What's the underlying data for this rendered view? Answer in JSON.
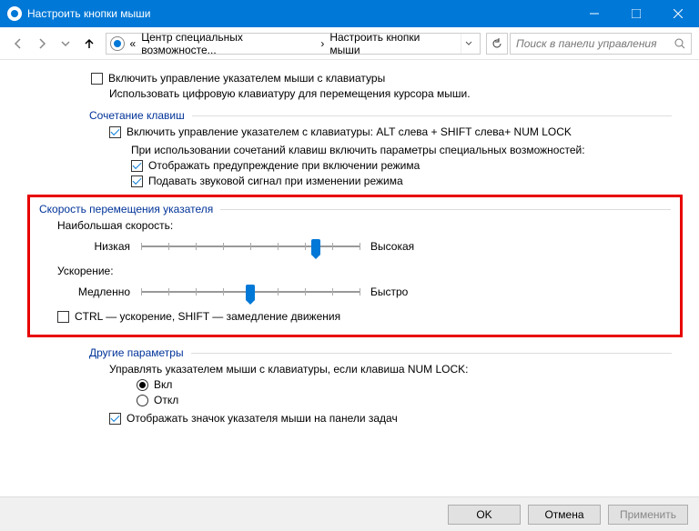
{
  "window": {
    "title": "Настроить кнопки мыши"
  },
  "breadcrumb": {
    "sep1": "«",
    "p1": "Центр специальных возможносте...",
    "sep2": "›",
    "p2": "Настроить кнопки мыши"
  },
  "search": {
    "placeholder": "Поиск в панели управления"
  },
  "opt": {
    "enable_keyboard": "Включить управление указателем мыши с клавиатуры",
    "subtitle": "Использовать цифровую клавиатуру для перемещения курсора мыши."
  },
  "shortcuts": {
    "header": "Сочетание клавиш",
    "enable": "Включить управление указателем с клавиатуры: ALT слева + SHIFT слева+ NUM LOCK",
    "note": "При использовании сочетаний клавиш включить параметры специальных возможностей:",
    "warn": "Отображать предупреждение при включении режима",
    "sound": "Подавать звуковой сигнал при изменении режима"
  },
  "speed": {
    "header": "Скорость перемещения указателя",
    "max_label": "Наибольшая скорость:",
    "low": "Низкая",
    "high": "Высокая",
    "accel_label": "Ускорение:",
    "slow": "Медленно",
    "fast": "Быстро",
    "ctrl": "CTRL — ускорение, SHIFT — замедление движения"
  },
  "other": {
    "header": "Другие параметры",
    "numlock": "Управлять указателем мыши с клавиатуры, если клавиша NUM LOCK:",
    "on": "Вкл",
    "off": "Откл",
    "tray": "Отображать значок указателя мыши на панели задач"
  },
  "buttons": {
    "ok": "OK",
    "cancel": "Отмена",
    "apply": "Применить"
  }
}
